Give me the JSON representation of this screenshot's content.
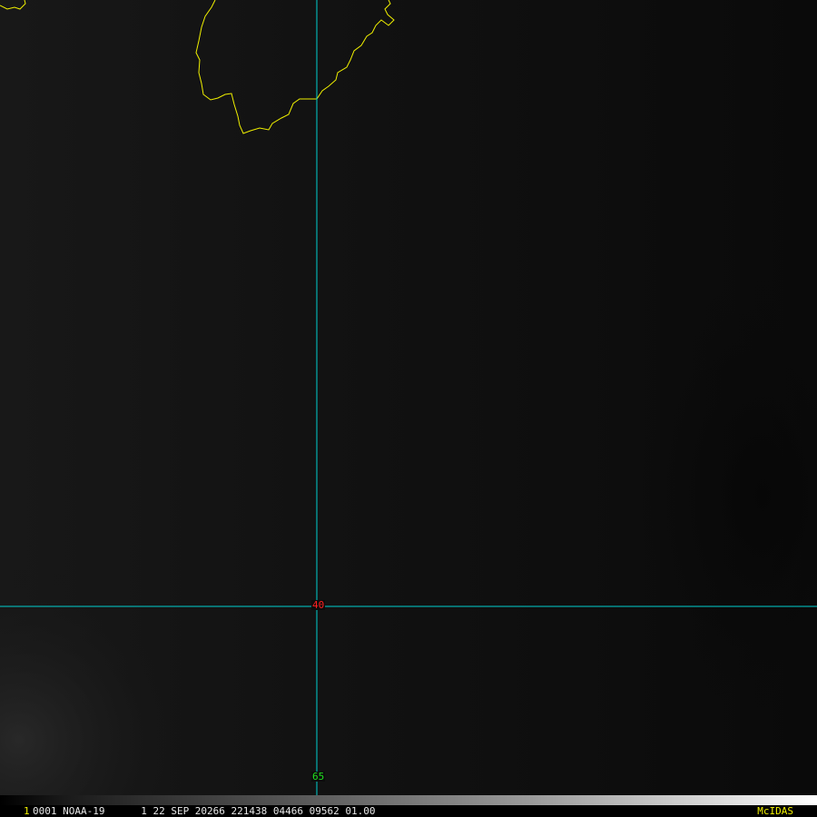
{
  "image": {
    "background_color": "#0c0c0c",
    "coastline_color": "#f0f000",
    "gridline_color": "#00d0d0"
  },
  "grid_labels": {
    "latitude": {
      "text": "40",
      "color": "#ff2020"
    },
    "longitude": {
      "text": "65",
      "color": "#20e020"
    }
  },
  "status_bar": {
    "frame_number": "1",
    "frame_number_color": "#f0f000",
    "header_text": "0001 NOAA-19      1 22 SEP 20266 221438 04466 09562 01.00",
    "brand": "McIDAS",
    "brand_color": "#f0f000"
  }
}
